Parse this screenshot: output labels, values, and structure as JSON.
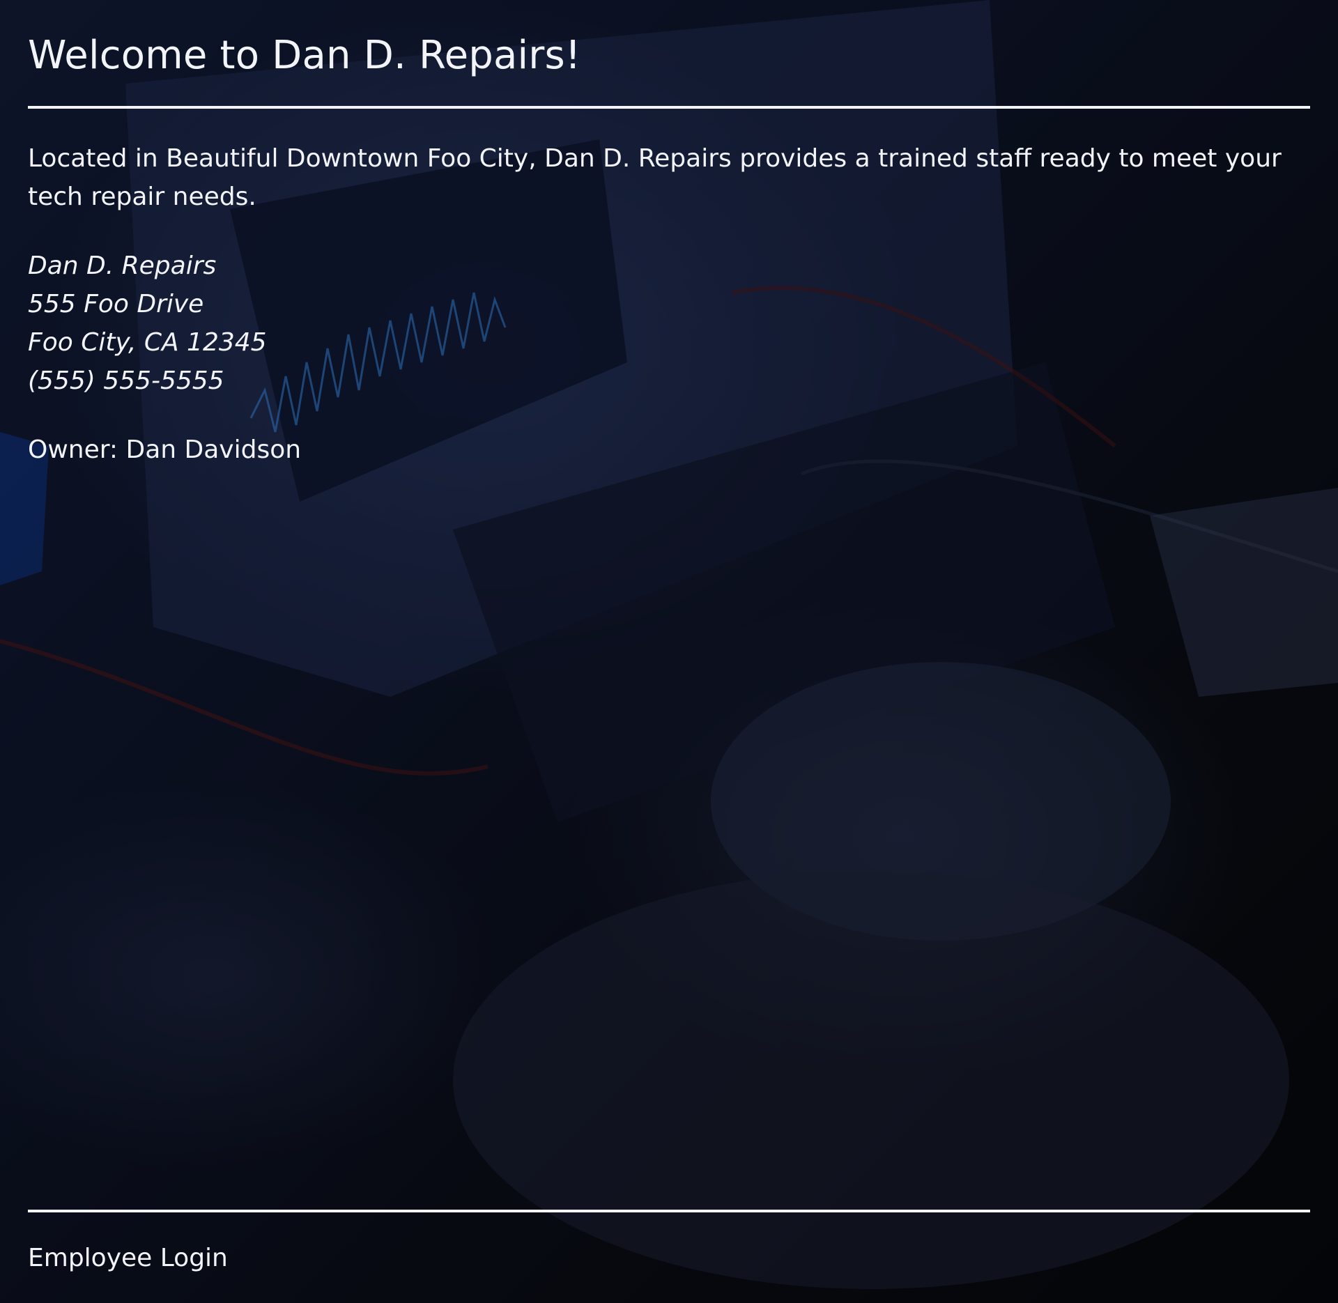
{
  "header": {
    "title": "Welcome to Dan D. Repairs!"
  },
  "main": {
    "intro": "Located in Beautiful Downtown Foo City, Dan D. Repairs provides a trained staff ready to meet your tech repair needs.",
    "address": {
      "name": "Dan D. Repairs",
      "street": "555 Foo Drive",
      "city_state_zip": "Foo City, CA 12345",
      "phone": "(555) 555-5555"
    },
    "owner": "Owner: Dan Davidson"
  },
  "footer": {
    "login_label": "Employee Login"
  },
  "colors": {
    "text": "#f2f4f8",
    "background": "#06080f"
  }
}
